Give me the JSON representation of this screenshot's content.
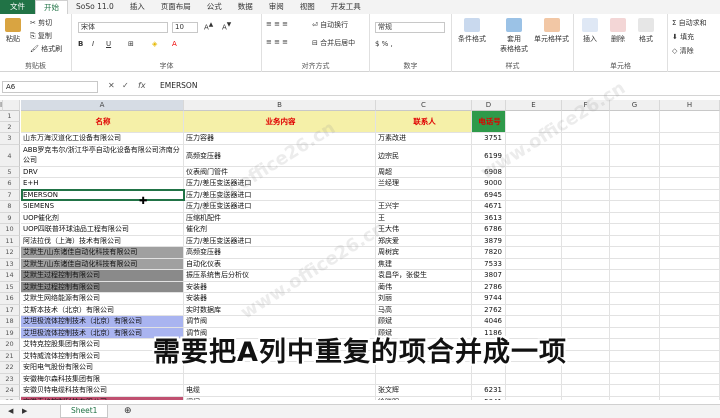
{
  "ribbon_tabs": [
    "文件",
    "开始",
    "SoSo 11.0",
    "插入",
    "页面布局",
    "公式",
    "数据",
    "审阅",
    "视图",
    "开发工具"
  ],
  "ribbon": {
    "clipboard": {
      "label": "剪贴板",
      "paste": "粘贴",
      "cut": "剪切",
      "copy": "复制",
      "format_painter": "格式刷"
    },
    "font": {
      "label": "字体",
      "name": "宋体",
      "size": "10"
    },
    "alignment": {
      "label": "对齐方式",
      "wrap": "自动换行",
      "merge": "合并后居中"
    },
    "number": {
      "label": "数字",
      "format": "常规"
    },
    "styles": {
      "label": "样式",
      "conditional": "条件格式",
      "table": "套用\n表格格式",
      "cell": "单元格样式"
    },
    "cells": {
      "label": "单元格",
      "insert": "插入",
      "delete": "删除",
      "format": "格式"
    },
    "editing": {
      "autosum": "自动求和",
      "fill": "填充",
      "clear": "清除"
    }
  },
  "formula_bar": {
    "name_box": "A6",
    "cancel": "✕",
    "enter": "✓",
    "fx": "fx",
    "value": "EMERSON"
  },
  "columns": [
    "A",
    "B",
    "C",
    "D",
    "E",
    "F",
    "G",
    "H",
    "I"
  ],
  "header": {
    "a": "名称",
    "b": "业务内容",
    "c": "联系人",
    "d": "电话号"
  },
  "rows": [
    {
      "n": "3",
      "a": "山东万海汉道化工设备有限公司",
      "b": "压力容器",
      "c": "万素改进",
      "d": "3751",
      "fill": ""
    },
    {
      "n": "4",
      "a": "ABB罗克韦尔/浙江华亭自动化设备有限公司济南分公司",
      "b": "高频变压器",
      "c": "边宗民",
      "d": "6199",
      "fill": "",
      "tall": true
    },
    {
      "n": "5",
      "a": "DRV",
      "b": "仪表阀门管件",
      "c": "周超",
      "d": "6908",
      "fill": ""
    },
    {
      "n": "6",
      "a": "E+H",
      "b": "压力/差压变送器进口",
      "c": "兰经理",
      "d": "9000",
      "fill": ""
    },
    {
      "n": "7",
      "a": "EMERSON",
      "b": "压力/差压变送器进口",
      "c": "",
      "d": "6945",
      "fill": "",
      "sel": true
    },
    {
      "n": "8",
      "a": "SIEMENS",
      "b": "压力/差压变送器进口",
      "c": "王兴宇",
      "d": "4671",
      "fill": ""
    },
    {
      "n": "9",
      "a": "UOP催化剂",
      "b": "压缩机配件",
      "c": "王",
      "d": "3613",
      "fill": ""
    },
    {
      "n": "10",
      "a": "UOP四联普环球油品工程有限公司",
      "b": "催化剂",
      "c": "王大伟",
      "d": "6786",
      "fill": ""
    },
    {
      "n": "11",
      "a": "阿法拉伐（上海）技术有限公司",
      "b": "压力/差压变送器进口",
      "c": "郑庆爱",
      "d": "3879",
      "fill": ""
    },
    {
      "n": "12",
      "a": "艾默生/山东诸佳自动化科技有限公司",
      "b": "高频变压器",
      "c": "周树宾",
      "d": "7820",
      "fill": "#a0a0a0"
    },
    {
      "n": "13",
      "a": "艾默生/山东诸佳自动化科技有限公司",
      "b": "自动化仪表",
      "c": "焦建",
      "d": "7533",
      "fill": "#a0a0a0"
    },
    {
      "n": "14",
      "a": "艾默生过程控制有限公司",
      "b": "振压系统售后分析仪",
      "c": "袁昌华，张俊生",
      "d": "3807",
      "fill": "#8a8a8a"
    },
    {
      "n": "15",
      "a": "艾默生过程控制有限公司",
      "b": "安装器",
      "c": "蔺伟",
      "d": "2786",
      "fill": "#8a8a8a"
    },
    {
      "n": "16",
      "a": "艾默生网络能源有限公司",
      "b": "安装器",
      "c": "刘丽",
      "d": "9744",
      "fill": ""
    },
    {
      "n": "17",
      "a": "艾斯本技术（北京）有限公司",
      "b": "实时数据库",
      "c": "马高",
      "d": "2762",
      "fill": ""
    },
    {
      "n": "18",
      "a": "艾坦极流体控制技术（北京）有限公司",
      "b": "调节阀",
      "c": "顾斌",
      "d": "4046",
      "fill": "#a9b4f0"
    },
    {
      "n": "19",
      "a": "艾坦极流体控制技术（北京）有限公司",
      "b": "调节阀",
      "c": "顾斌",
      "d": "1186",
      "fill": "#a9b4f0"
    },
    {
      "n": "20",
      "a": "艾特克控股集团有限公司",
      "b": "",
      "c": "",
      "d": "",
      "fill": ""
    },
    {
      "n": "21",
      "a": "艾特威流体控制有限公司",
      "b": "",
      "c": "",
      "d": "",
      "fill": ""
    },
    {
      "n": "22",
      "a": "安阳电气股份有限公司",
      "b": "",
      "c": "",
      "d": "",
      "fill": ""
    },
    {
      "n": "23",
      "a": "安徽梅尔森科技集团有限",
      "b": "",
      "c": "",
      "d": "",
      "fill": ""
    },
    {
      "n": "24",
      "a": "安徽贝特电缆科技有限公司",
      "b": "电缆",
      "c": "张文辉",
      "d": "6231",
      "fill": ""
    },
    {
      "n": "25",
      "a": "安徽泰格控制科技有限公司",
      "b": "阀门",
      "c": "徐晓明",
      "d": "5041",
      "fill": "#c05070"
    }
  ],
  "caption": "需要把A列中重复的项合并成一项",
  "sheet_tab": "Sheet1",
  "add_sheet": "⊕",
  "watermark": "www.office26.cn"
}
